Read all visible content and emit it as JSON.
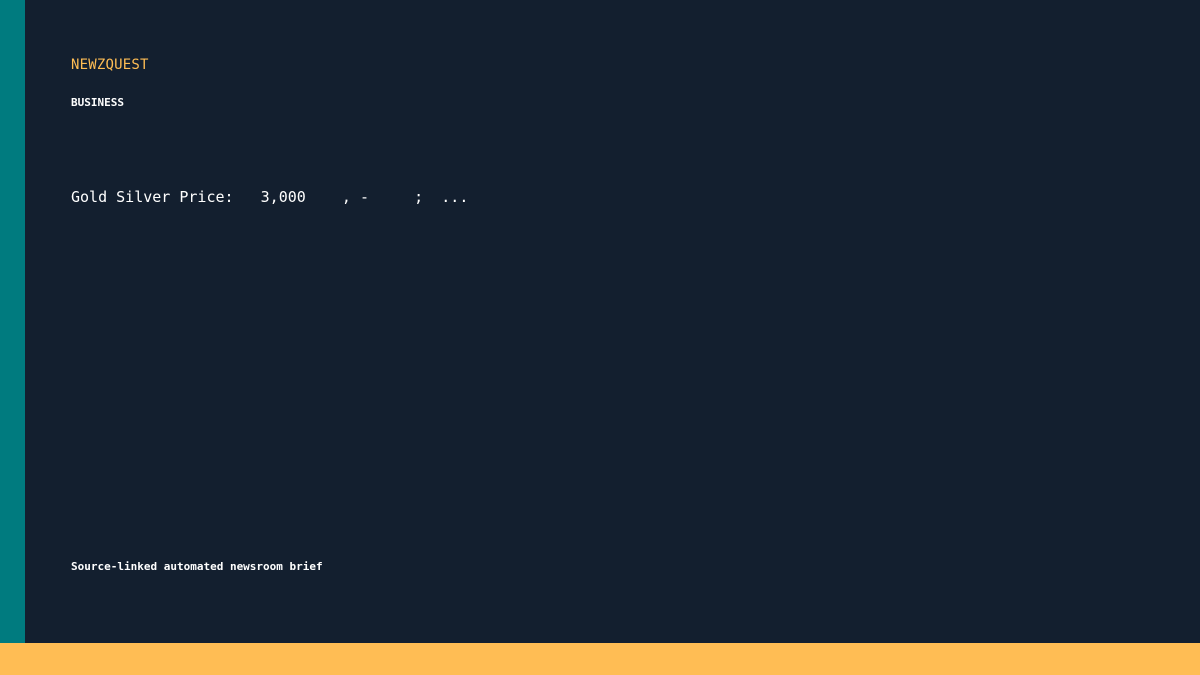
{
  "brand": "NEWZQUEST",
  "category": "BUSINESS",
  "headline": "Gold Silver Price:   3,000    , -     ;  ...",
  "footer_note": "Source-linked automated newsroom brief",
  "colors": {
    "background": "#131f2f",
    "accent_teal": "#007b7f",
    "accent_gold": "#ffbd54",
    "text": "#ffffff"
  }
}
